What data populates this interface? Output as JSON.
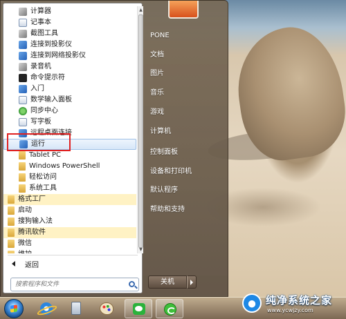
{
  "start_menu": {
    "programs": [
      {
        "label": "计算器",
        "icon": "calculator-icon"
      },
      {
        "label": "记事本",
        "icon": "notepad-icon"
      },
      {
        "label": "截图工具",
        "icon": "snipping-tool-icon"
      },
      {
        "label": "连接到投影仪",
        "icon": "projector-icon"
      },
      {
        "label": "连接到网络投影仪",
        "icon": "network-projector-icon"
      },
      {
        "label": "录音机",
        "icon": "sound-recorder-icon"
      },
      {
        "label": "命令提示符",
        "icon": "command-prompt-icon"
      },
      {
        "label": "入门",
        "icon": "getting-started-icon"
      },
      {
        "label": "数学输入面板",
        "icon": "math-input-icon"
      },
      {
        "label": "同步中心",
        "icon": "sync-center-icon"
      },
      {
        "label": "写字板",
        "icon": "wordpad-icon"
      },
      {
        "label": "远程桌面连接",
        "icon": "remote-desktop-icon"
      },
      {
        "label": "运行",
        "icon": "run-icon"
      },
      {
        "label": "Tablet PC",
        "icon": "folder-icon"
      },
      {
        "label": "Windows PowerShell",
        "icon": "folder-icon"
      },
      {
        "label": "轻松访问",
        "icon": "folder-icon"
      },
      {
        "label": "系统工具",
        "icon": "folder-icon"
      },
      {
        "label": "格式工厂",
        "icon": "folder-icon"
      },
      {
        "label": "启动",
        "icon": "folder-icon"
      },
      {
        "label": "搜狗输入法",
        "icon": "folder-icon"
      },
      {
        "label": "腾讯软件",
        "icon": "folder-icon"
      },
      {
        "label": "微信",
        "icon": "folder-icon"
      },
      {
        "label": "维护",
        "icon": "folder-icon"
      }
    ],
    "back_label": "返回",
    "search_placeholder": "搜索程序和文件",
    "right_items": [
      "PONE",
      "文档",
      "图片",
      "音乐",
      "游戏",
      "计算机",
      "控制面板",
      "设备和打印机",
      "默认程序",
      "帮助和支持"
    ],
    "shutdown_label": "关机"
  },
  "taskbar": {
    "buttons": [
      "start-orb",
      "internet-explorer-icon",
      "calculator-icon",
      "paint-icon",
      "wechat-icon",
      "green-browser-icon"
    ]
  },
  "watermark": {
    "title": "纯净系统之家",
    "url": "www.ycwjzy.com"
  }
}
